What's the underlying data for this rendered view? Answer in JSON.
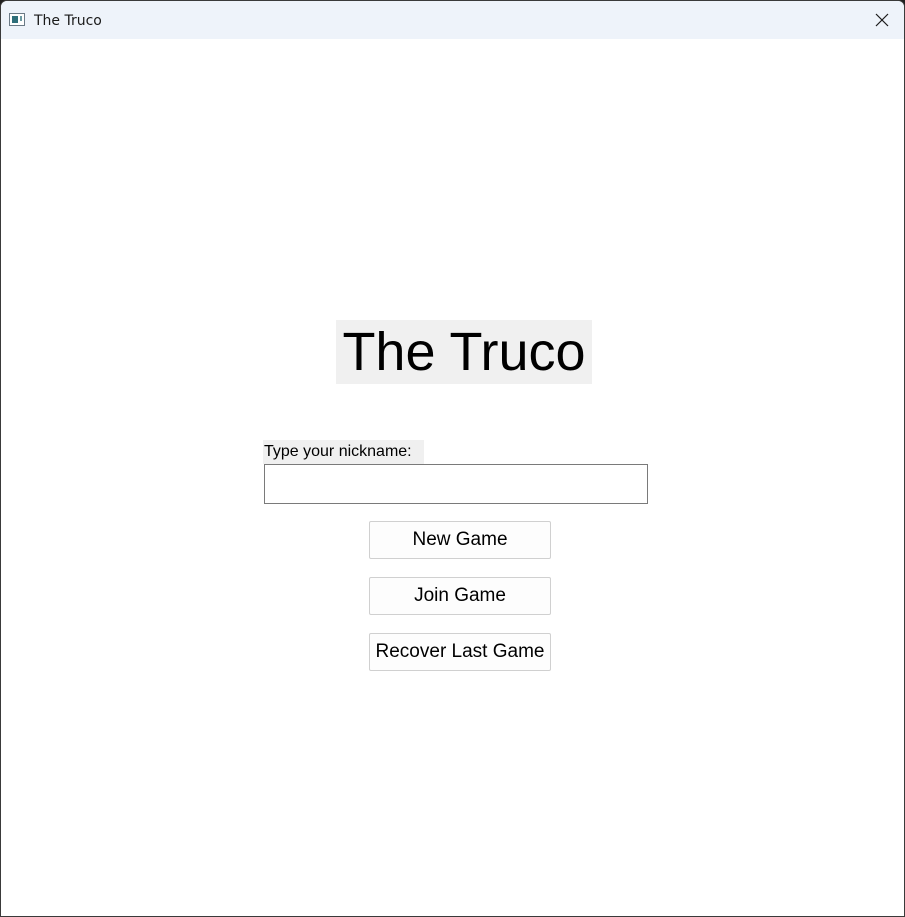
{
  "window": {
    "title": "The Truco",
    "icon": "app-window-icon",
    "close_icon": "close-icon"
  },
  "main": {
    "heading": "The Truco",
    "nickname_label": "Type your nickname:",
    "nickname_value": "",
    "buttons": {
      "new_game": "New Game",
      "join_game": "Join Game",
      "recover_last_game": "Recover Last Game"
    }
  },
  "colors": {
    "titlebar_bg": "#eef3fa",
    "label_bg": "#f0f0f0",
    "button_bg": "#fdfdfd",
    "button_border": "#d0d0d0"
  }
}
